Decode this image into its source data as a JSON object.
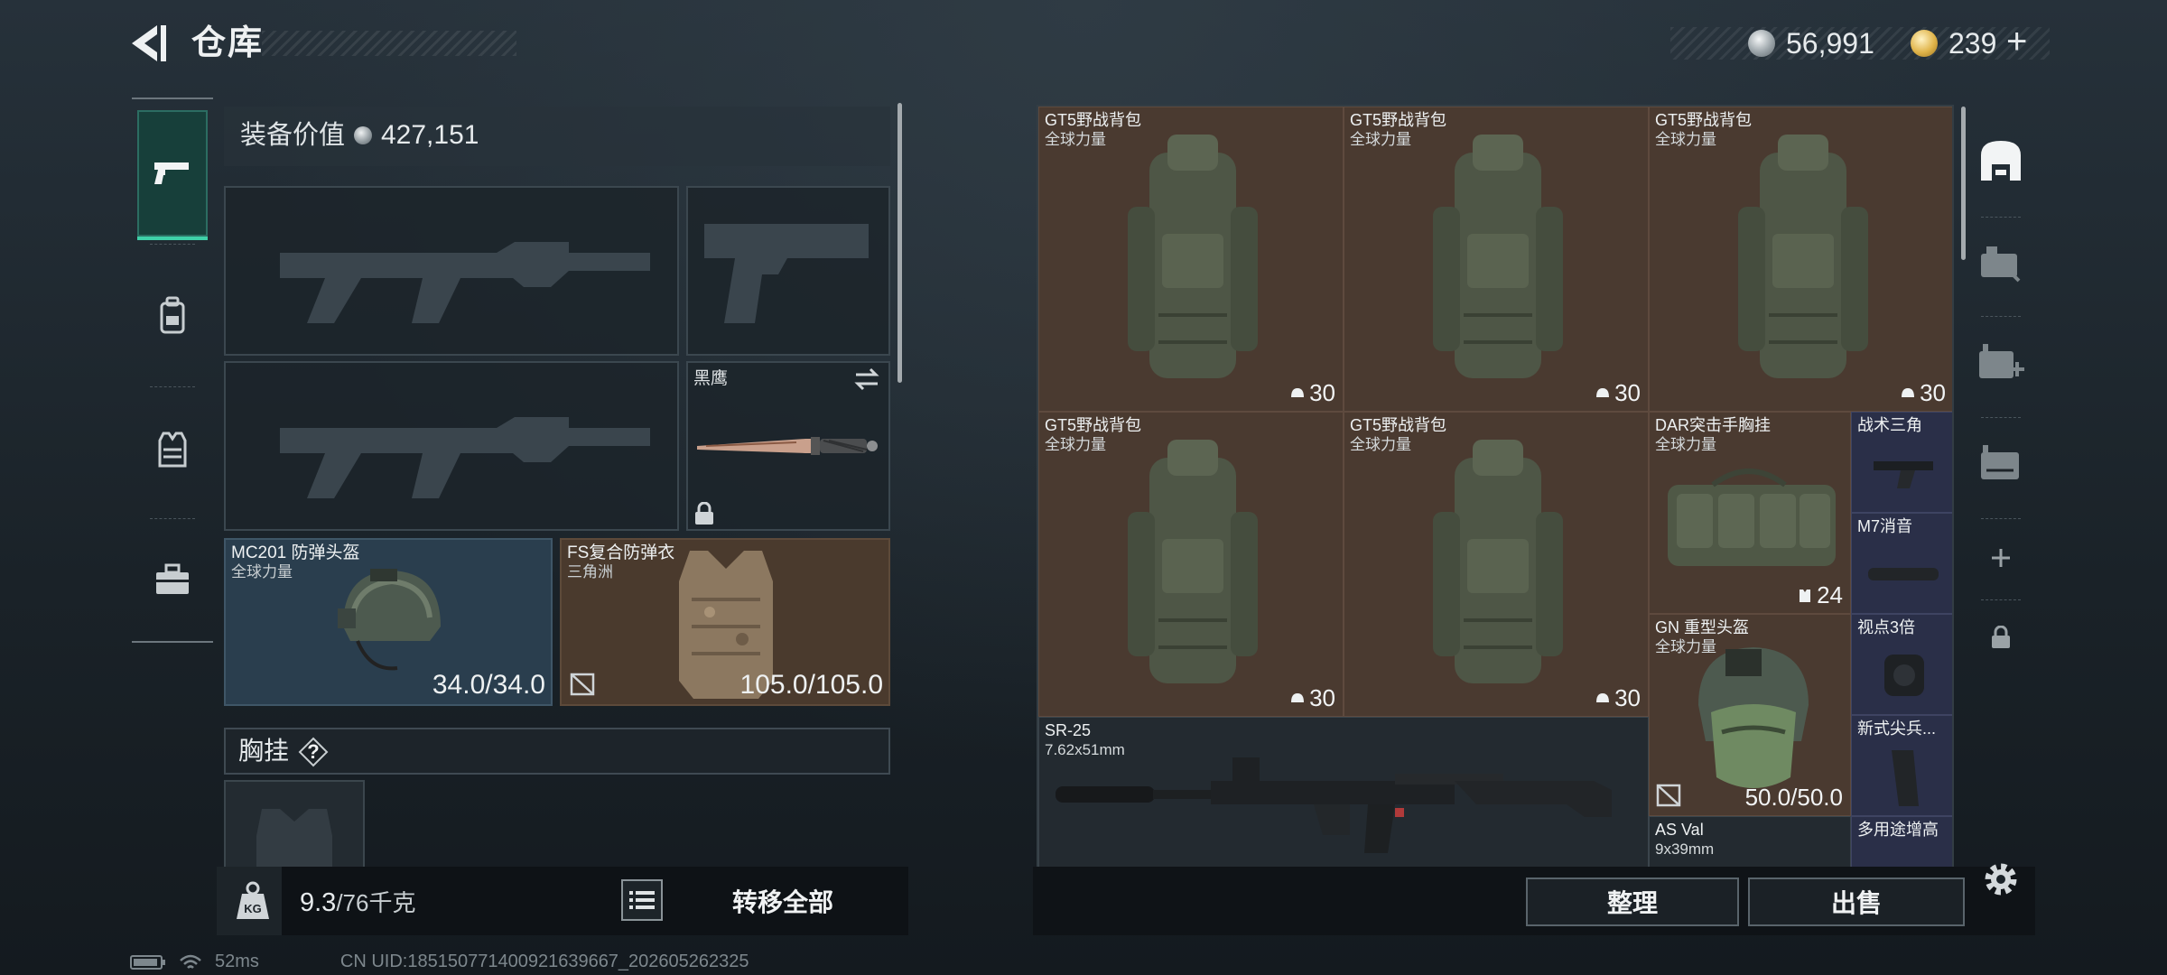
{
  "header": {
    "title": "仓库",
    "currency_silver": "56,991",
    "currency_gold": "239",
    "currency_gold_plus": "+"
  },
  "equipment": {
    "value_label": "装备价值",
    "value": "427,151",
    "knife_name": "黑鹰",
    "helmet": {
      "name": "MC201 防弹头盔",
      "faction": "全球力量",
      "durability": "34.0/34.0"
    },
    "armor": {
      "name": "FS复合防弹衣",
      "faction": "三角洲",
      "durability": "105.0/105.0"
    },
    "chest_label": "胸挂",
    "chest_help": "?"
  },
  "footer_left": {
    "weight": "9.3",
    "weight_max": "/76千克",
    "transfer_all": "转移全部"
  },
  "stash": {
    "items": [
      {
        "name": "GT5野战背包",
        "faction": "全球力量",
        "count": "30"
      },
      {
        "name": "GT5野战背包",
        "faction": "全球力量",
        "count": "30"
      },
      {
        "name": "GT5野战背包",
        "faction": "全球力量",
        "count": "30"
      },
      {
        "name": "GT5野战背包",
        "faction": "全球力量",
        "count": "30"
      },
      {
        "name": "GT5野战背包",
        "faction": "全球力量",
        "count": "30"
      },
      {
        "name": "DAR突击手胸挂",
        "faction": "全球力量",
        "count": "24"
      },
      {
        "name": "战术三角"
      },
      {
        "name": "M7消音"
      },
      {
        "name": "GN 重型头盔",
        "faction": "全球力量",
        "durability": "50.0/50.0"
      },
      {
        "name": "视点3倍"
      },
      {
        "name": "新式尖兵..."
      },
      {
        "name": "SR-25",
        "caliber": "7.62x51mm"
      },
      {
        "name": "AS Val",
        "caliber": "9x39mm"
      },
      {
        "name": "多用途增高"
      }
    ],
    "sort_label": "整理",
    "sell_label": "出售"
  },
  "status": {
    "ping": "52ms",
    "uid": "CN UID:185150771400921639667_202605262325"
  },
  "colors": {
    "accent": "#3fd0a8",
    "bag_cell": "#4a3a30",
    "blue_cell": "#2a2f48",
    "helmet_card": "#2a3e4e",
    "armor_card": "#4a3a2d"
  },
  "icons": [
    "back-arrow-icon",
    "silver-coin-icon",
    "gold-coin-icon",
    "pistol-icon",
    "backpack-icon",
    "vest-icon",
    "toolbox-icon",
    "swap-icon",
    "lock-icon",
    "broken-armor-icon",
    "weight-icon",
    "list-icon",
    "helmet-count-icon",
    "vest-count-icon",
    "stash-icon",
    "case-icon",
    "medkit-icon",
    "folder-icon",
    "plus-icon",
    "gear-icon",
    "battery-icon",
    "wifi-icon"
  ]
}
